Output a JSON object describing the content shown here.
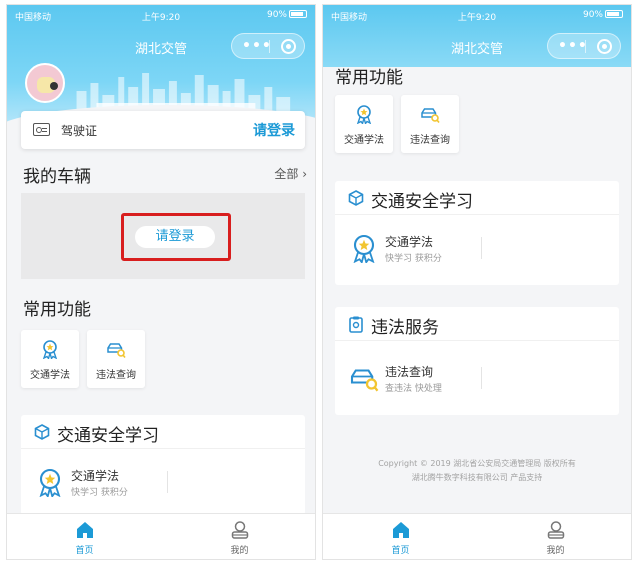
{
  "status_bar": {
    "carrier": "中国移动",
    "time": "上午9:20",
    "battery": "90%"
  },
  "nav": {
    "title": "湖北交管",
    "menu_label": "•••"
  },
  "colors": {
    "accent": "#1c9ad6",
    "header_blue": "#5cc8f0",
    "highlight_red": "#d81e1e"
  },
  "left": {
    "license": {
      "label": "驾驶证",
      "login": "请登录"
    },
    "vehicles": {
      "title": "我的车辆",
      "more": "全部",
      "more_arrow": "›",
      "login": "请登录"
    },
    "common": {
      "title": "常用功能",
      "items": [
        {
          "label": "交通学法",
          "icon": "medal-icon"
        },
        {
          "label": "违法查询",
          "icon": "car-search-icon"
        }
      ]
    },
    "learning": {
      "title": "交通安全学习",
      "items": [
        {
          "title": "交通学法",
          "subtitle": "快学习 获积分",
          "icon": "medal-icon"
        }
      ]
    }
  },
  "right": {
    "common": {
      "title": "常用功能",
      "items": [
        {
          "label": "交通学法",
          "icon": "medal-icon"
        },
        {
          "label": "违法查询",
          "icon": "car-search-icon"
        }
      ]
    },
    "learning": {
      "title": "交通安全学习",
      "items": [
        {
          "title": "交通学法",
          "subtitle": "快学习 获积分",
          "icon": "medal-icon"
        }
      ]
    },
    "violation": {
      "title": "违法服务",
      "items": [
        {
          "title": "违法查询",
          "subtitle": "查违法 快处理",
          "icon": "car-search-icon"
        }
      ]
    },
    "footer": {
      "line1": "Copyright © 2019 湖北省公安局交通管理局 版权所有",
      "line2": "湖北腾牛数字科技有限公司 产品支持"
    }
  },
  "tabbar": {
    "home": {
      "label": "首页",
      "icon": "home-icon"
    },
    "mine": {
      "label": "我的",
      "icon": "person-icon"
    }
  }
}
